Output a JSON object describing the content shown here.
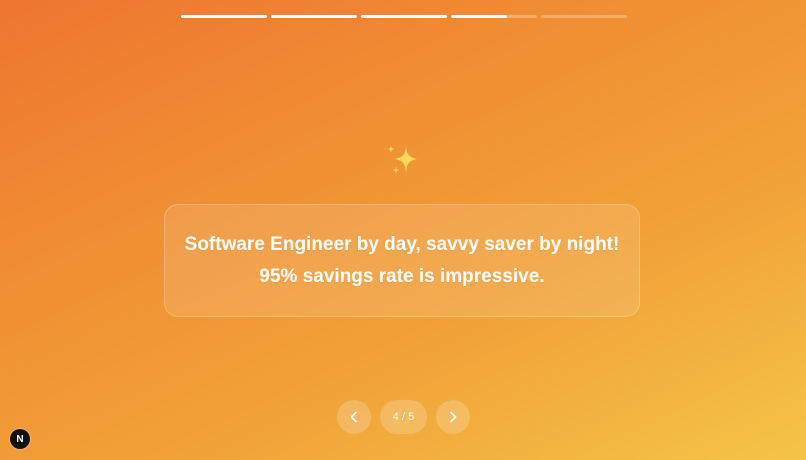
{
  "progress": {
    "segments": [
      1,
      1,
      1,
      0.65,
      0
    ]
  },
  "sparkle_icon": "sparkles-icon",
  "card": {
    "line1": "Software Engineer by day, savvy saver by night!",
    "line2": "95% savings rate is impressive."
  },
  "nav": {
    "prev_icon": "chevron-left-icon",
    "next_icon": "chevron-right-icon",
    "counter": "4 / 5"
  },
  "dev_badge": {
    "label": "N"
  },
  "colors": {
    "gradient_start": "#ee7530",
    "gradient_end": "#f4c447",
    "sparkle": "#ffd95a"
  }
}
